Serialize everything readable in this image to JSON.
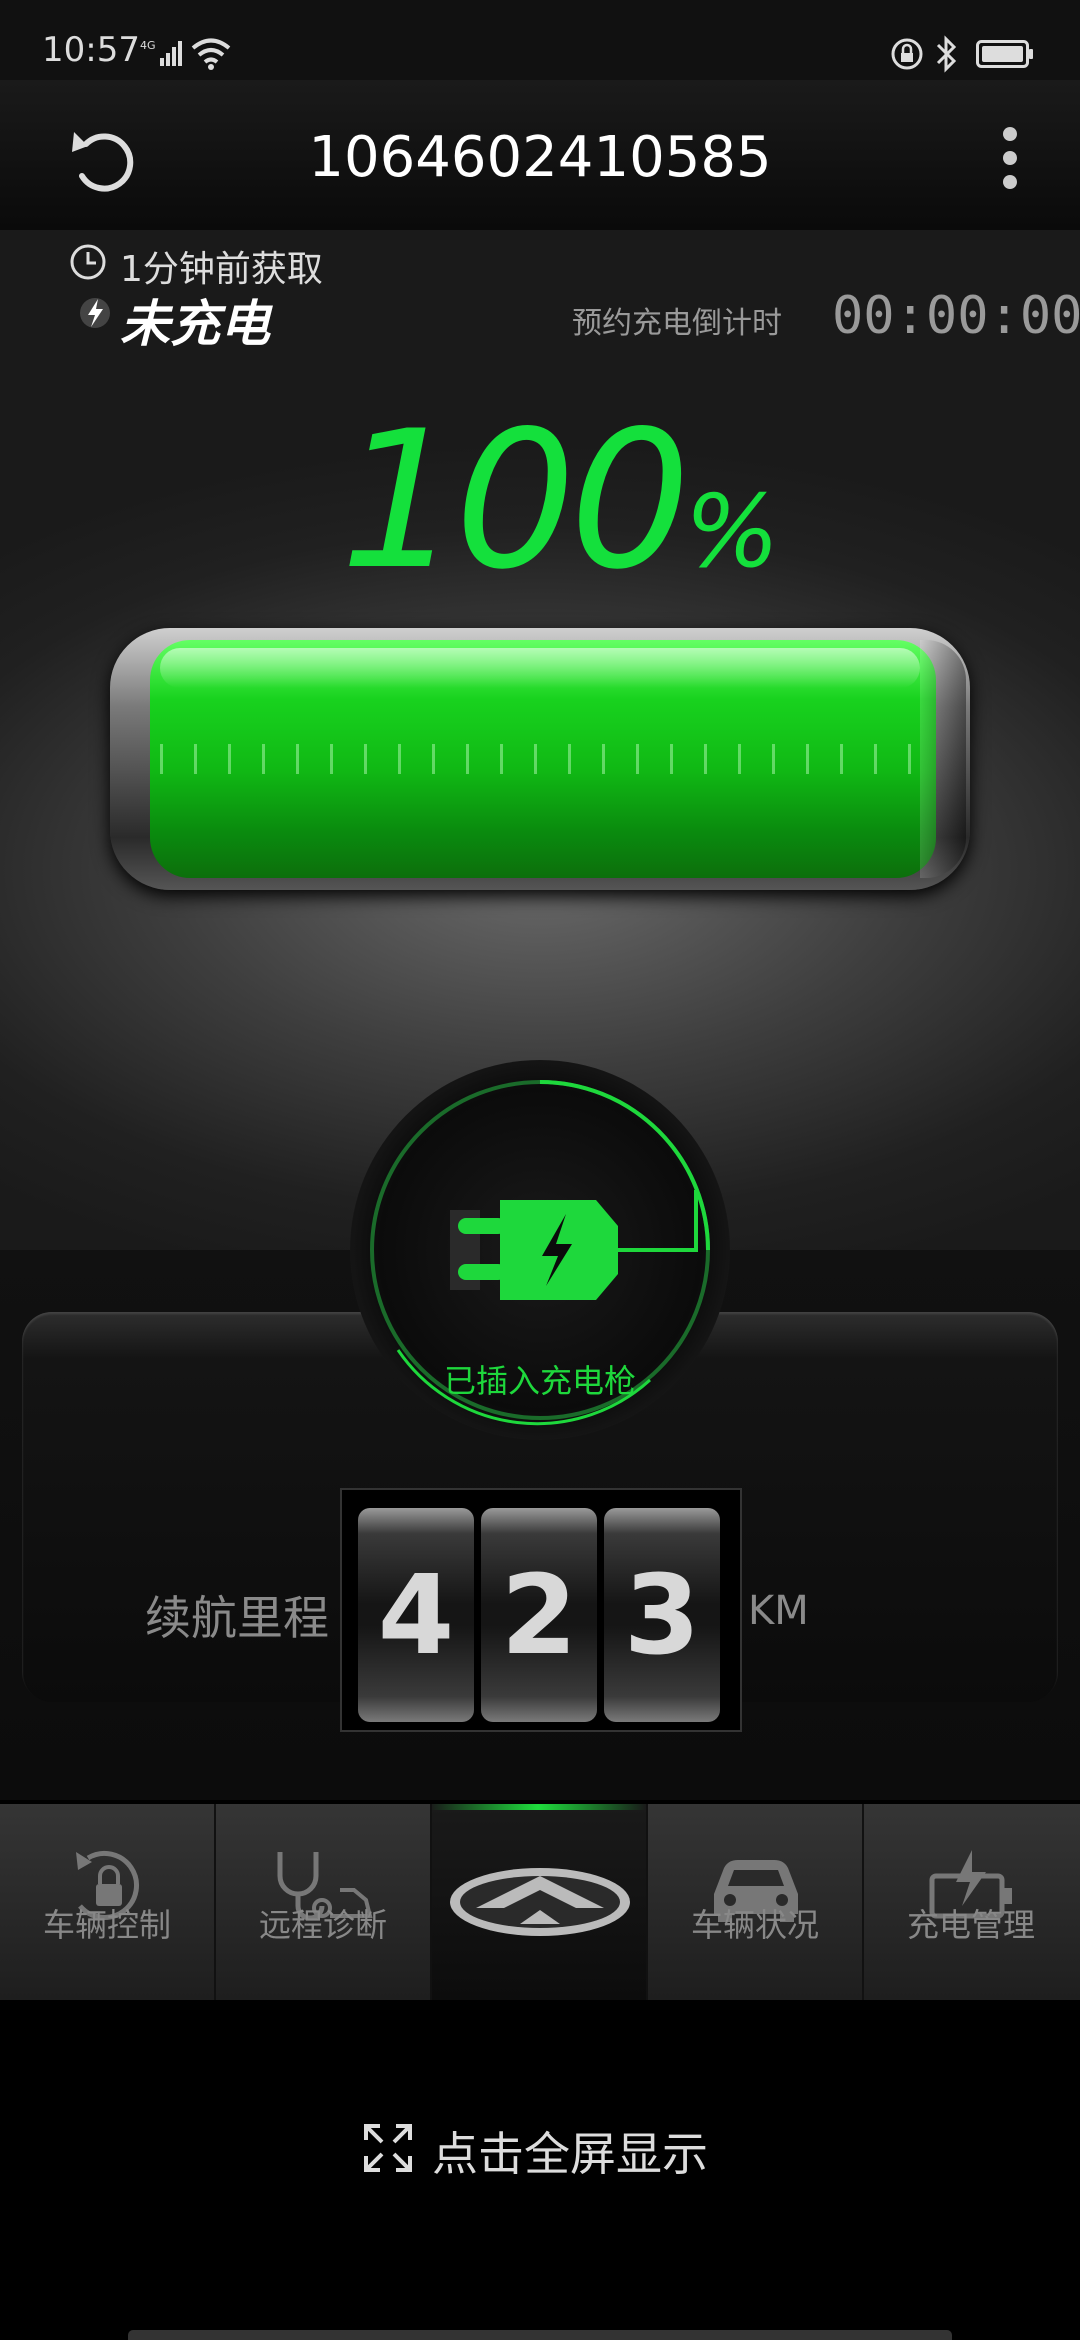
{
  "status_bar": {
    "time": "10:57",
    "network": "4G"
  },
  "header": {
    "vehicle_id": "1064602410585"
  },
  "charge": {
    "fetched_time": "1分钟前获取",
    "status": "未充电",
    "countdown_label": "预约充电倒计时",
    "countdown": "00:00:00",
    "percent_value": "100",
    "percent_sign": "%",
    "battery_level": 1.0,
    "plug_status": "已插入充电枪"
  },
  "range": {
    "label": "续航里程",
    "digits": [
      "4",
      "2",
      "3"
    ],
    "unit": "KM"
  },
  "nav": {
    "items": [
      {
        "label": "车辆控制",
        "icon": "lock-refresh-icon"
      },
      {
        "label": "远程诊断",
        "icon": "stethoscope-car-icon"
      },
      {
        "label": "",
        "icon": "brand-logo-icon"
      },
      {
        "label": "车辆状况",
        "icon": "car-icon"
      },
      {
        "label": "充电管理",
        "icon": "battery-charge-icon"
      }
    ]
  },
  "footer": {
    "fullscreen_label": "点击全屏显示"
  },
  "colors": {
    "accent_green": "#14e03c",
    "text_gray": "#8a8a8a"
  }
}
